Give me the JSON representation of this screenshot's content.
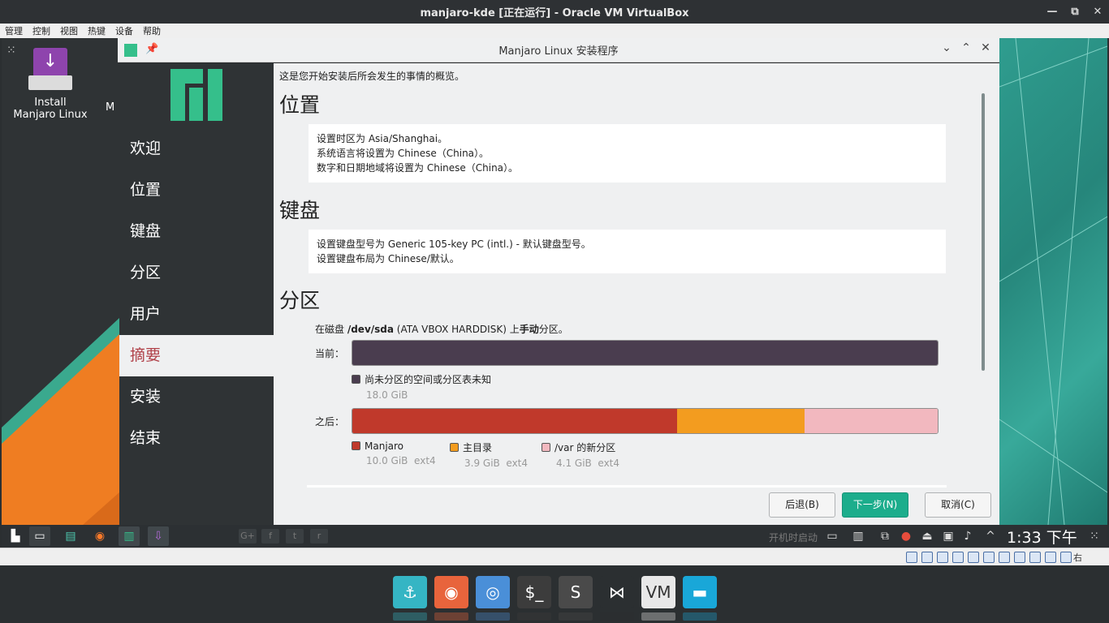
{
  "host": {
    "window_title": "manjaro-kde [正在运行] - Oracle VM VirtualBox",
    "window_controls": [
      "—",
      "⧉",
      "✕"
    ],
    "menu": [
      "管理",
      "控制",
      "视图",
      "热键",
      "设备",
      "帮助"
    ],
    "host_key": "右 Ctrl"
  },
  "desktop": {
    "install_icon_label_1": "Install",
    "install_icon_label_2": "Manjaro Linux",
    "second_icon_label": "M"
  },
  "installer": {
    "title": "Manjaro Linux 安装程序",
    "sidebar": [
      {
        "label": "欢迎",
        "active": false
      },
      {
        "label": "位置",
        "active": false
      },
      {
        "label": "键盘",
        "active": false
      },
      {
        "label": "分区",
        "active": false
      },
      {
        "label": "用户",
        "active": false
      },
      {
        "label": "摘要",
        "active": true
      },
      {
        "label": "安装",
        "active": false
      },
      {
        "label": "结束",
        "active": false
      }
    ],
    "intro": "这是您开始安装后所会发生的事情的概览。",
    "location": {
      "heading": "位置",
      "lines": [
        "设置时区为 Asia/Shanghai。",
        "系统语言将设置为 Chinese（China）。",
        "数字和日期地域将设置为 Chinese（China）。"
      ]
    },
    "keyboard": {
      "heading": "键盘",
      "lines": [
        "设置键盘型号为 Generic 105-key PC (intl.) - 默认键盘型号。",
        "设置键盘布局为 Chinese/默认。"
      ]
    },
    "partition": {
      "heading": "分区",
      "desc_prefix": "在磁盘 ",
      "disk": "/dev/sda",
      "desc_middle": " (ATA VBOX HARDDISK) 上",
      "mode": "手动",
      "desc_suffix": "分区。",
      "current_label": "当前：",
      "after_label": "之后：",
      "current_bar": [
        {
          "name": "尚未分区的空间或分区表未知",
          "size": "18.0 GiB",
          "fs": "",
          "color": "#4a3d4f",
          "fraction": 1.0
        }
      ],
      "after_bar": [
        {
          "name": "Manjaro",
          "size": "10.0 GiB",
          "fs": "ext4",
          "color": "#c0392b",
          "fraction": 0.555
        },
        {
          "name": "主目录",
          "size": "3.9 GiB",
          "fs": "ext4",
          "color": "#f39c1f",
          "fraction": 0.217
        },
        {
          "name": "/var 的新分区",
          "size": "4.1 GiB",
          "fs": "ext4",
          "color": "#f2b8bf",
          "fraction": 0.228
        }
      ]
    },
    "buttons": {
      "back": "后退(B)",
      "next": "下一步(N)",
      "cancel": "取消(C)"
    }
  },
  "taskbar": {
    "dim_icons": [
      "G+",
      "f",
      "t",
      "r"
    ],
    "autostart_text": "开机时启动",
    "clock": "1:33 下午"
  },
  "dock": {
    "items": [
      {
        "name": "anchor-icon",
        "color": "#35b5c4",
        "glyph": "⚓"
      },
      {
        "name": "firefox-icon",
        "color": "#e8643c",
        "glyph": "◉"
      },
      {
        "name": "chrome-icon",
        "color": "#4a8fd8",
        "glyph": "◎"
      },
      {
        "name": "terminal-icon",
        "color": "#3c3c3c",
        "glyph": "$_"
      },
      {
        "name": "sublime-icon",
        "color": "#4a4a4a",
        "glyph": "S"
      },
      {
        "name": "vscode-icon",
        "color": "#2b2f31",
        "glyph": "⋈"
      },
      {
        "name": "vmware-icon",
        "color": "#e8e8e8",
        "glyph": "VM"
      },
      {
        "name": "files-icon",
        "color": "#19a7d8",
        "glyph": "▬"
      }
    ]
  }
}
